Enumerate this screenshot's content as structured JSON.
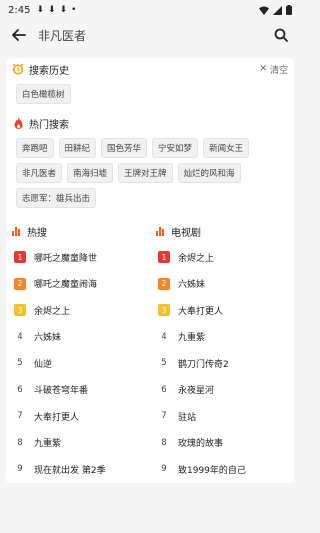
{
  "status": {
    "time": "2:45"
  },
  "search": {
    "value": "非凡医者"
  },
  "history": {
    "title": "搜索历史",
    "clear_label": "清空",
    "items": [
      "白色橄榄树"
    ]
  },
  "hot_search": {
    "title": "热门搜索",
    "items": [
      "奔跑吧",
      "田耕纪",
      "国色芳华",
      "宁安如梦",
      "新闻女王",
      "非凡医者",
      "南海归墟",
      "王牌对王牌",
      "灿烂的风和海",
      "志愿军：雄兵出击"
    ]
  },
  "ranking": {
    "left": {
      "title": "热搜",
      "items": [
        {
          "rank": "1",
          "title": "哪吒之魔童降世"
        },
        {
          "rank": "2",
          "title": "哪吒之魔童闹海"
        },
        {
          "rank": "3",
          "title": "余烬之上"
        },
        {
          "rank": "4",
          "title": "六姊妹"
        },
        {
          "rank": "5",
          "title": "仙逆"
        },
        {
          "rank": "6",
          "title": "斗破苍穹年番"
        },
        {
          "rank": "7",
          "title": "大奉打更人"
        },
        {
          "rank": "8",
          "title": "九重紫"
        },
        {
          "rank": "9",
          "title": "现在就出发 第2季"
        }
      ]
    },
    "right": {
      "title": "电视剧",
      "items": [
        {
          "rank": "1",
          "title": "余烬之上"
        },
        {
          "rank": "2",
          "title": "六姊妹"
        },
        {
          "rank": "3",
          "title": "大奉打更人"
        },
        {
          "rank": "4",
          "title": "九重紫"
        },
        {
          "rank": "5",
          "title": "鹊刀门传奇2"
        },
        {
          "rank": "6",
          "title": "永夜星河"
        },
        {
          "rank": "7",
          "title": "驻站"
        },
        {
          "rank": "8",
          "title": "玫瑰的故事"
        },
        {
          "rank": "9",
          "title": "致1999年的自己"
        }
      ]
    }
  },
  "colors": {
    "rank1": "#e53935",
    "rank2": "#f08a24",
    "rank3": "#f2c12e",
    "accent": "#e85b2f"
  }
}
